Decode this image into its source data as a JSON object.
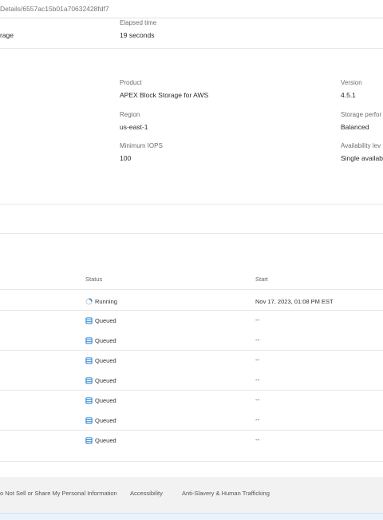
{
  "breadcrumb": "Details/6557ac15b01a70632428fdf7",
  "summary": {
    "left_truncated": "rage",
    "elapsed_label": "Elapsed time",
    "elapsed_value": "19 seconds"
  },
  "details": {
    "product_label": "Product",
    "product_value": "APEX Block Storage for AWS",
    "version_label": "Version",
    "version_value": "4.5.1",
    "region_label": "Region",
    "region_value": "us-east-1",
    "storage_perf_label": "Storage perfor",
    "storage_perf_value": "Balanced",
    "min_iops_label": "Minimum IOPS",
    "min_iops_value": "100",
    "availability_label": "Availability lev",
    "availability_value": "Single availabi"
  },
  "table": {
    "headers": {
      "status": "Status",
      "start": "Start"
    },
    "rows": [
      {
        "status": "Running",
        "icon": "spinner-icon",
        "start": "Nov 17, 2023, 01:08 PM EST"
      },
      {
        "status": "Queued",
        "icon": "queue-icon",
        "start": "--"
      },
      {
        "status": "Queued",
        "icon": "queue-icon",
        "start": "--"
      },
      {
        "status": "Queued",
        "icon": "queue-icon",
        "start": "--"
      },
      {
        "status": "Queued",
        "icon": "queue-icon",
        "start": "--"
      },
      {
        "status": "Queued",
        "icon": "queue-icon",
        "start": "--"
      },
      {
        "status": "Queued",
        "icon": "queue-icon",
        "start": "--"
      },
      {
        "status": "Queued",
        "icon": "queue-icon",
        "start": "--"
      }
    ]
  },
  "footer": {
    "do_not_sell": "o Not Sell or Share My Personal Information",
    "accessibility": "Accessibility",
    "anti_slavery": "Anti-Slavery & Human Trafficking"
  },
  "colors": {
    "accent": "#0672cb",
    "footer_bg": "#f2f2f2"
  }
}
